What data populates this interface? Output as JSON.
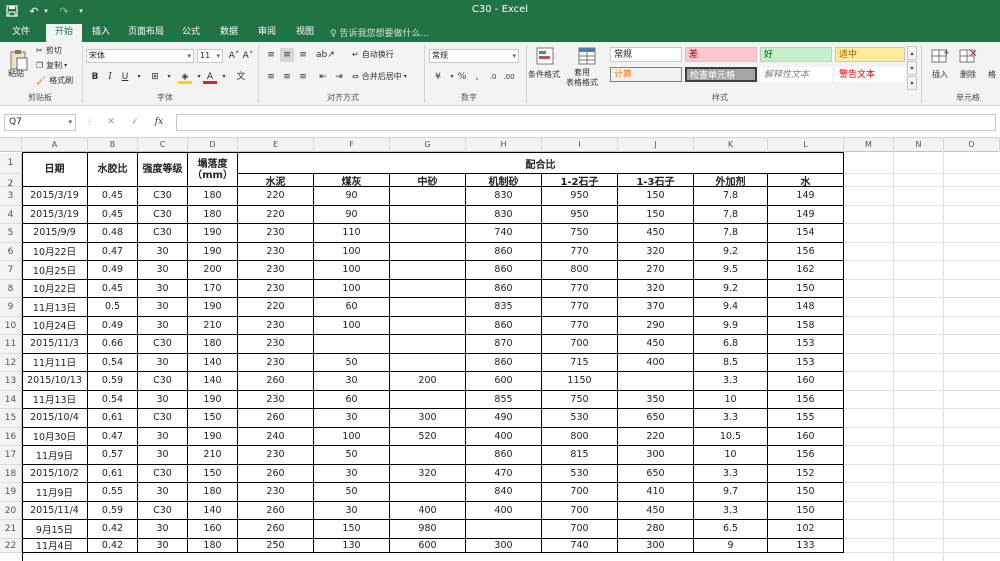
{
  "window": {
    "title": "C30 - Excel"
  },
  "tabs": [
    "文件",
    "开始",
    "插入",
    "页面布局",
    "公式",
    "数据",
    "审阅",
    "视图"
  ],
  "tell_me": "告诉我您想要做什么...",
  "ribbon": {
    "clipboard": {
      "paste": "粘贴",
      "cut": "剪切",
      "copy": "复制",
      "format_painter": "格式刷",
      "label": "剪贴板"
    },
    "font": {
      "name": "宋体",
      "size": "11",
      "label": "字体"
    },
    "alignment": {
      "wrap": "自动换行",
      "merge": "合并后居中",
      "label": "对齐方式"
    },
    "number": {
      "format": "常规",
      "label": "数字"
    },
    "styles": {
      "cond_format": "条件格式",
      "table_format": "套用\n表格格式",
      "normal": "常规",
      "bad": "差",
      "good": "好",
      "neutral": "适中",
      "calc": "计算",
      "check": "检查单元格",
      "explain": "解释性文本",
      "warn": "警告文本",
      "label": "样式"
    },
    "cells": {
      "insert": "插入",
      "delete": "删除",
      "format": "格",
      "label": "单元格"
    }
  },
  "name_box": "Q7",
  "columns": [
    "A",
    "B",
    "C",
    "D",
    "E",
    "F",
    "G",
    "H",
    "I",
    "J",
    "K",
    "L",
    "M",
    "N",
    "O"
  ],
  "rows": [
    "1",
    "2",
    "3",
    "4",
    "5",
    "6",
    "7",
    "8",
    "9",
    "10",
    "11",
    "12",
    "13",
    "14",
    "15",
    "16",
    "17",
    "18",
    "19",
    "20",
    "21",
    "22"
  ],
  "header": {
    "date": "日期",
    "wc": "水胶比",
    "grade": "强度等级",
    "slump": "塌落度（mm）",
    "mix": "配合比",
    "cement": "水泥",
    "flyash": "煤灰",
    "sand": "中砂",
    "msand": "机制砂",
    "st12": "1-2石子",
    "st13": "1-3石子",
    "admix": "外加剂",
    "water": "水"
  },
  "data": [
    [
      "2015/3/19",
      "0.45",
      "C30",
      "180",
      "220",
      "90",
      "",
      "830",
      "950",
      "150",
      "7.8",
      "149"
    ],
    [
      "2015/3/19",
      "0.45",
      "C30",
      "180",
      "220",
      "90",
      "",
      "830",
      "950",
      "150",
      "7.8",
      "149"
    ],
    [
      "2015/9/9",
      "0.48",
      "C30",
      "190",
      "230",
      "110",
      "",
      "740",
      "750",
      "450",
      "7.8",
      "154"
    ],
    [
      "10月22日",
      "0.47",
      "30",
      "190",
      "230",
      "100",
      "",
      "860",
      "770",
      "320",
      "9.2",
      "156"
    ],
    [
      "10月25日",
      "0.49",
      "30",
      "200",
      "230",
      "100",
      "",
      "860",
      "800",
      "270",
      "9.5",
      "162"
    ],
    [
      "10月22日",
      "0.45",
      "30",
      "170",
      "230",
      "100",
      "",
      "860",
      "770",
      "320",
      "9.2",
      "150"
    ],
    [
      "11月13日",
      "0.5",
      "30",
      "190",
      "220",
      "60",
      "",
      "835",
      "770",
      "370",
      "9.4",
      "148"
    ],
    [
      "10月24日",
      "0.49",
      "30",
      "210",
      "230",
      "100",
      "",
      "860",
      "770",
      "290",
      "9.9",
      "158"
    ],
    [
      "2015/11/3",
      "0.66",
      "C30",
      "180",
      "230",
      "",
      "",
      "870",
      "700",
      "450",
      "6.8",
      "153"
    ],
    [
      "11月11日",
      "0.54",
      "30",
      "140",
      "230",
      "50",
      "",
      "860",
      "715",
      "400",
      "8.5",
      "153"
    ],
    [
      "2015/10/13",
      "0.59",
      "C30",
      "140",
      "260",
      "30",
      "200",
      "600",
      "1150",
      "",
      "3.3",
      "160"
    ],
    [
      "11月13日",
      "0.54",
      "30",
      "190",
      "230",
      "60",
      "",
      "855",
      "750",
      "350",
      "10",
      "156"
    ],
    [
      "2015/10/4",
      "0.61",
      "C30",
      "150",
      "260",
      "30",
      "300",
      "490",
      "530",
      "650",
      "3.3",
      "155"
    ],
    [
      "10月30日",
      "0.47",
      "30",
      "190",
      "240",
      "100",
      "520",
      "400",
      "800",
      "220",
      "10.5",
      "160"
    ],
    [
      "11月9日",
      "0.57",
      "30",
      "210",
      "230",
      "50",
      "",
      "860",
      "815",
      "300",
      "10",
      "156"
    ],
    [
      "2015/10/2",
      "0.61",
      "C30",
      "150",
      "260",
      "30",
      "320",
      "470",
      "530",
      "650",
      "3.3",
      "152"
    ],
    [
      "11月9日",
      "0.55",
      "30",
      "180",
      "230",
      "50",
      "",
      "840",
      "700",
      "410",
      "9.7",
      "150"
    ],
    [
      "2015/11/4",
      "0.59",
      "C30",
      "140",
      "260",
      "30",
      "400",
      "400",
      "700",
      "450",
      "3.3",
      "150"
    ],
    [
      "9月15日",
      "0.42",
      "30",
      "160",
      "260",
      "150",
      "980",
      "",
      "700",
      "280",
      "6.5",
      "102"
    ],
    [
      "11月4日",
      "0.42",
      "30",
      "180",
      "250",
      "130",
      "600",
      "300",
      "740",
      "300",
      "9",
      "133"
    ]
  ]
}
